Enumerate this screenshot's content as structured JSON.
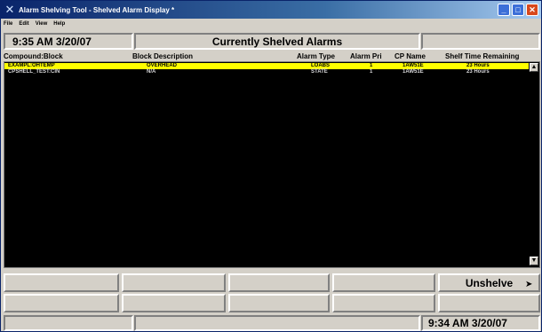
{
  "window": {
    "title": "Alarm Shelving Tool - Shelved Alarm Display *",
    "controls": [
      "minimize-icon",
      "maximize-icon",
      "close-icon"
    ]
  },
  "menu": [
    "File",
    "Edit",
    "View",
    "Help"
  ],
  "header": {
    "time": "9:35 AM 3/20/07",
    "heading": "Currently Shelved Alarms"
  },
  "columns": [
    "Compound:Block",
    "Block Description",
    "Alarm Type",
    "Alarm Pri",
    "CP Name",
    "Shelf Time Remaining"
  ],
  "rows": [
    {
      "compound": "EXAMPL:OHTEMP",
      "description": "OVERHEAD",
      "type": "LOABS",
      "pri": "1",
      "cp": "1AW51E",
      "remaining": "23 Hours",
      "selected": true
    },
    {
      "compound": "CPSHELL_TEST:CIN",
      "description": "N/A",
      "type": "STATE",
      "pri": "1",
      "cp": "1AW51E",
      "remaining": "23 Hours",
      "selected": false
    }
  ],
  "buttons": {
    "unshelve": "Unshelve"
  },
  "status": {
    "time": "9:34 AM 3/20/07"
  },
  "colors": {
    "list_bg": "#000000",
    "selected_row": "#ffff00",
    "titlebar": "#0a246a"
  }
}
